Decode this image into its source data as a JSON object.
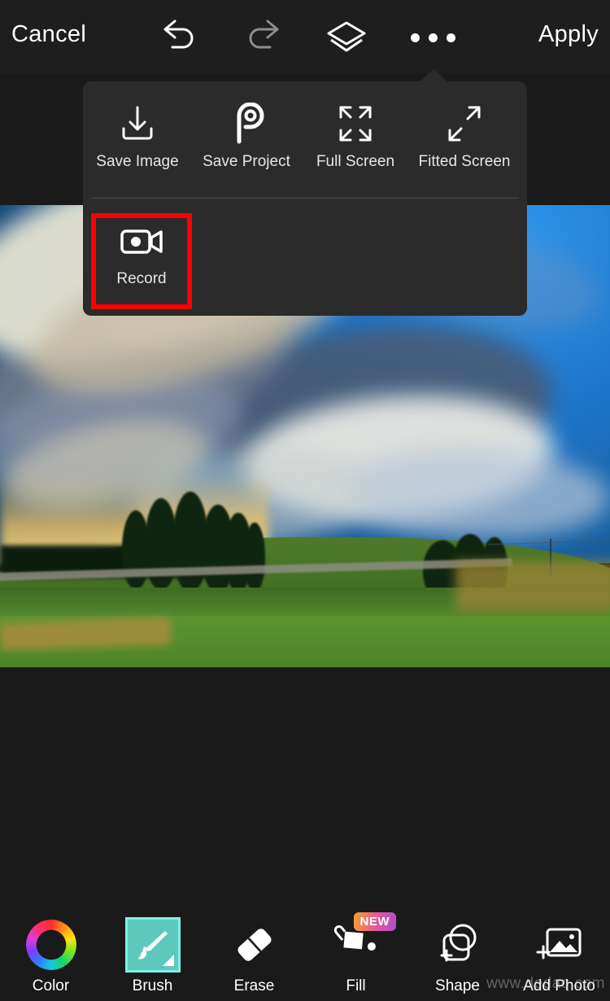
{
  "topbar": {
    "cancel_label": "Cancel",
    "apply_label": "Apply",
    "undo_icon": "undo-arrow-icon",
    "redo_icon": "redo-arrow-icon",
    "layers_icon": "layers-icon",
    "more_icon": "three-dots-icon"
  },
  "menu": {
    "row1": [
      {
        "label": "Save Image",
        "icon": "download-icon"
      },
      {
        "label": "Save Project",
        "icon": "picsart-logo-icon"
      },
      {
        "label": "Full Screen",
        "icon": "expand-four-arrows-icon"
      },
      {
        "label": "Fitted Screen",
        "icon": "fit-two-arrows-icon"
      }
    ],
    "row2": [
      {
        "label": "Record",
        "icon": "video-camera-icon",
        "highlighted": true
      }
    ],
    "highlight_color": "#ff0000"
  },
  "toolbar": {
    "tools": [
      {
        "label": "Color",
        "icon": "color-wheel-icon",
        "selected": false,
        "badge": ""
      },
      {
        "label": "Brush",
        "icon": "paint-brush-icon",
        "selected": true,
        "badge": ""
      },
      {
        "label": "Erase",
        "icon": "eraser-icon",
        "selected": false,
        "badge": ""
      },
      {
        "label": "Fill",
        "icon": "paint-bucket-icon",
        "selected": false,
        "badge": "NEW"
      },
      {
        "label": "Shape",
        "icon": "shapes-icon",
        "selected": false,
        "badge": ""
      },
      {
        "label": "Add Photo",
        "icon": "add-photo-icon",
        "selected": false,
        "badge": ""
      }
    ],
    "selected_color": "#5ec8bd",
    "badge_text": "NEW"
  },
  "canvas": {
    "alt": "landscape photo of dramatic clouds over green field at sunset"
  },
  "watermark": {
    "text": "www.dedaq.com"
  }
}
